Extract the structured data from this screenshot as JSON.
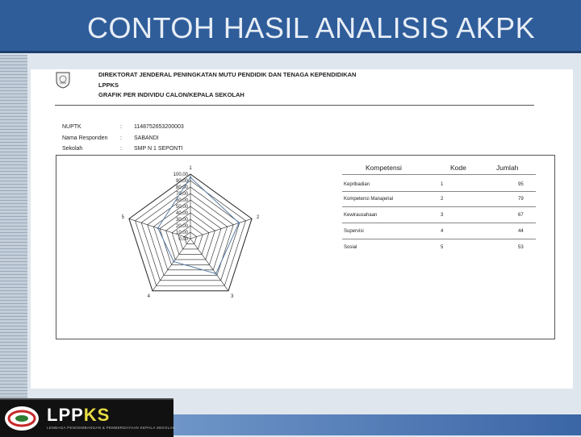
{
  "slide": {
    "title": "CONTOH HASIL ANALISIS AKPK"
  },
  "report": {
    "header_line1": "DIREKTORAT JENDERAL PENINGKATAN MUTU PENDIDIK DAN TENAGA KEPENDIDIKAN",
    "header_line2": "LPPKS",
    "header_line3": "GRAFIK PER INDIVIDU CALON/KEPALA SEKOLAH",
    "fields": [
      {
        "label": "NUPTK",
        "value": "1148752653200003"
      },
      {
        "label": "Nama Responden",
        "value": "SABANDI"
      },
      {
        "label": "Sekolah",
        "value": "SMP N 1 SEPONTI"
      }
    ],
    "table": {
      "headers": [
        "Kompetensi",
        "Kode",
        "Jumlah"
      ],
      "rows": [
        [
          "Kepribadian",
          "1",
          "95"
        ],
        [
          "Kompetensi Manajerial",
          "2",
          "79"
        ],
        [
          "Kewirausahaan",
          "3",
          "67"
        ],
        [
          "Supervisi",
          "4",
          "44"
        ],
        [
          "Sosial",
          "5",
          "53"
        ]
      ]
    }
  },
  "chart_data": {
    "type": "radar",
    "categories": [
      "1",
      "2",
      "3",
      "4",
      "5"
    ],
    "values": [
      95,
      79,
      67,
      44,
      53
    ],
    "ylim": [
      0,
      100
    ],
    "ticks": [
      "100,00",
      "90,00",
      "80,00",
      "70,00",
      "60,00",
      "50,00",
      "40,00",
      "30,00",
      "20,00",
      "10,00",
      "0,00"
    ],
    "grid": true,
    "series_color": "#5b7fa6"
  },
  "logo": {
    "name_part1": "LPP",
    "name_part2": "KS",
    "subtitle": "LEMBAGA PENGEMBANGAN & PEMBERDAYAAN KEPALA SEKOLAH"
  },
  "colors": {
    "title_bar": "#2f5d9a",
    "title_text": "#e8eef6"
  }
}
